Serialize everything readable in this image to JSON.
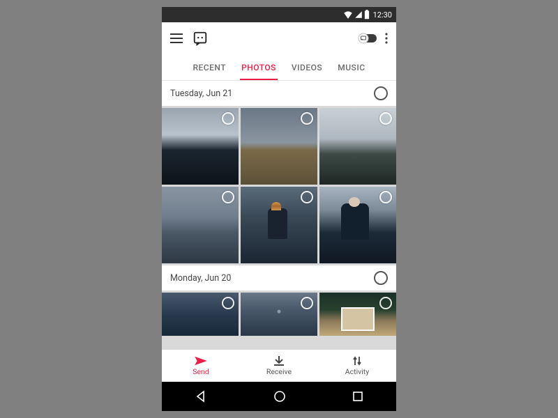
{
  "statusbar": {
    "time": "12:30"
  },
  "tabs": [
    "RECENT",
    "PHOTOS",
    "VIDEOS",
    "MUSIC"
  ],
  "active_tab_index": 1,
  "sections": [
    {
      "label": "Tuesday, Jun 21"
    },
    {
      "label": "Monday, Jun 20"
    }
  ],
  "bottombar": {
    "items": [
      {
        "label": "Send"
      },
      {
        "label": "Receive"
      },
      {
        "label": "Activity"
      }
    ],
    "active_index": 0
  },
  "colors": {
    "accent": "#e91e47"
  }
}
